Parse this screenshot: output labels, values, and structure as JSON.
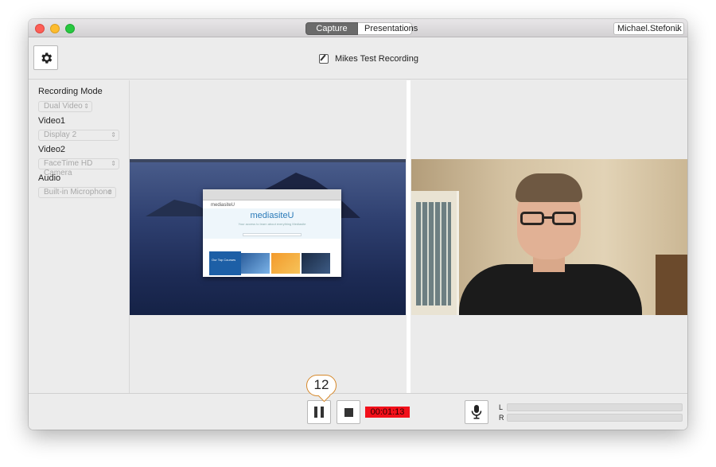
{
  "titlebar": {
    "tabs": [
      {
        "label": "Capture",
        "active": true
      },
      {
        "label": "Presentations",
        "active": false
      }
    ],
    "user": "Michael.Stefonik"
  },
  "toolbar": {
    "recording_title": "Mikes Test Recording"
  },
  "sidebar": {
    "recording_mode": {
      "label": "Recording Mode",
      "value": "Dual Video"
    },
    "video1": {
      "label": "Video1",
      "value": "Display 2"
    },
    "video2": {
      "label": "Video2",
      "value": "FaceTime HD Camera"
    },
    "audio": {
      "label": "Audio",
      "value": "Built-in Microphone"
    }
  },
  "preview": {
    "browser_brand": "mediasiteU",
    "browser_logo": "mediasiteU",
    "browser_tagline": "Your access to learn about everything Mediasite",
    "course_title": "Our Top Courses"
  },
  "controls": {
    "timer": "00:01:13",
    "meter_left_label": "L",
    "meter_right_label": "R",
    "meter_left_level": 0,
    "meter_right_level": 0
  },
  "callout": {
    "number": "12"
  },
  "colors": {
    "timer_bg": "#f2101a",
    "callout_border": "#d6882a",
    "active_tab_bg": "#6b6b6b"
  }
}
